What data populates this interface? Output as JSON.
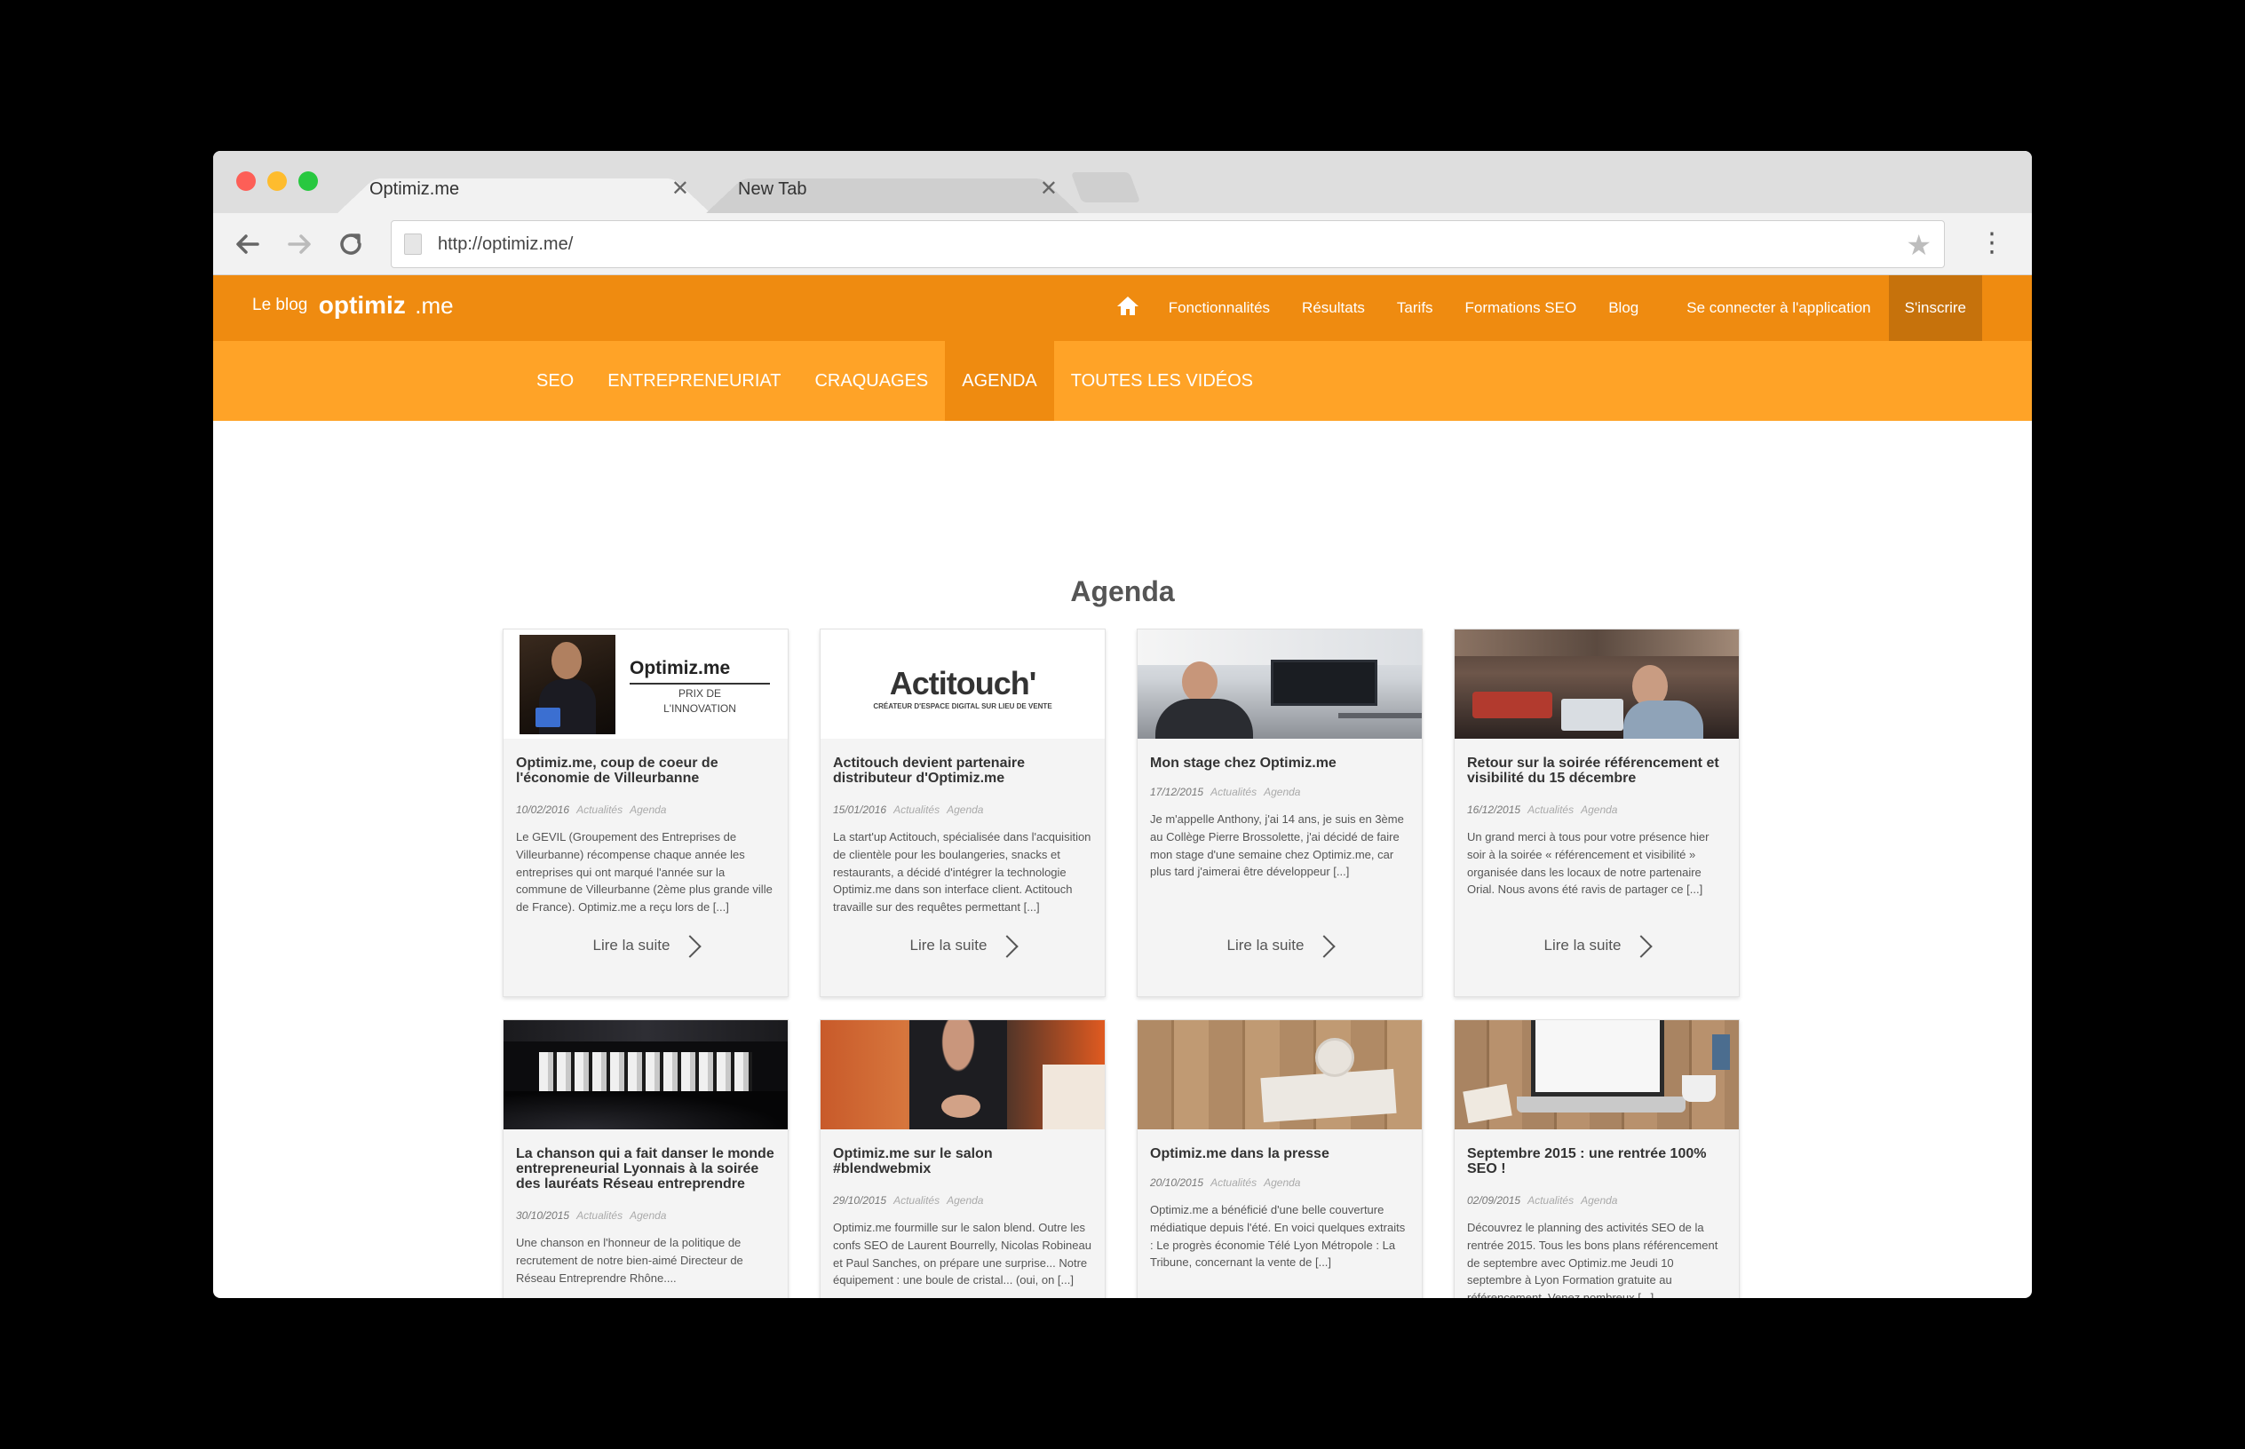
{
  "browser": {
    "tabs": [
      {
        "title": "Optimiz.me",
        "close": "✕"
      },
      {
        "title": "New Tab",
        "close": "✕"
      }
    ],
    "url": "http://optimiz.me/"
  },
  "site": {
    "brand_prefix": "Le blog",
    "brand_logo": "optimiz",
    "brand_suffix": ".me",
    "main_nav": [
      "Fonctionnalités",
      "Résultats",
      "Tarifs",
      "Formations SEO",
      "Blog",
      "Se connecter à l'application"
    ],
    "cta": "S'inscrire",
    "categories": [
      "SEO",
      "ENTREPRENEURIAT",
      "CRAQUAGES",
      "AGENDA",
      "TOUTES LES VIDÉOS"
    ],
    "active_category": "AGENDA",
    "colors": {
      "header": "#ef8b10",
      "category_bar": "#ffa327",
      "cta": "#c6720c"
    }
  },
  "section_title": "Agenda",
  "read_more": "Lire la suite",
  "thumbs": {
    "optimiz_brand": "Optimiz.me",
    "optimiz_prize_line1": "PRIX DE",
    "optimiz_prize_line2": "L'INNOVATION",
    "actitouch_brand": "Actitouch'",
    "actitouch_tagline": "CRÉATEUR D'ESPACE DIGITAL SUR LIEU DE VENTE"
  },
  "cards": [
    {
      "title": "Optimiz.me, coup de coeur de l'économie de Villeurbanne",
      "date": "10/02/2016",
      "tags": [
        "Actualités",
        "Agenda"
      ],
      "excerpt": "Le GEVIL (Groupement des Entreprises de Villeurbanne) récompense chaque année les entreprises qui ont marqué l'année sur la commune de Villeurbanne (2ème plus grande ville de France). Optimiz.me a reçu lors de [...]"
    },
    {
      "title": "Actitouch devient partenaire distributeur d'Optimiz.me",
      "date": "15/01/2016",
      "tags": [
        "Actualités",
        "Agenda"
      ],
      "excerpt": "La start'up Actitouch, spécialisée dans l'acquisition de clientèle pour les boulangeries, snacks et restaurants, a décidé d'intégrer la technologie Optimiz.me dans son interface client. Actitouch travaille sur des requêtes permettant [...]"
    },
    {
      "title": "Mon stage chez Optimiz.me",
      "date": "17/12/2015",
      "tags": [
        "Actualités",
        "Agenda"
      ],
      "excerpt": "Je m'appelle Anthony, j'ai 14 ans, je suis en 3ème au Collège Pierre Brossolette, j'ai décidé de faire mon stage d'une semaine chez Optimiz.me, car plus tard j'aimerai être développeur [...]"
    },
    {
      "title": "Retour sur la soirée référencement et visibilité du 15 décembre",
      "date": "16/12/2015",
      "tags": [
        "Actualités",
        "Agenda"
      ],
      "excerpt": "Un grand merci à tous pour votre présence hier soir à la soirée « référencement et visibilité » organisée dans les locaux de notre partenaire Orial. Nous avons été ravis de partager ce [...]"
    },
    {
      "title": "La chanson qui a fait danser le monde entrepreneurial Lyonnais à la soirée des lauréats Réseau entreprendre",
      "date": "30/10/2015",
      "tags": [
        "Actualités",
        "Agenda"
      ],
      "excerpt": "Une chanson en l'honneur de la politique de recrutement de notre bien-aimé Directeur de Réseau Entreprendre Rhône...."
    },
    {
      "title": "Optimiz.me sur le salon #blendwebmix",
      "date": "29/10/2015",
      "tags": [
        "Actualités",
        "Agenda"
      ],
      "excerpt": "Optimiz.me fourmille sur le salon blend. Outre les confs SEO de Laurent Bourrelly, Nicolas Robineau et Paul Sanches, on prépare une surprise... Notre équipement : une boule de cristal... (oui, on [...]"
    },
    {
      "title": "Optimiz.me dans la presse",
      "date": "20/10/2015",
      "tags": [
        "Actualités",
        "Agenda"
      ],
      "excerpt": "Optimiz.me a bénéficié d'une belle couverture médiatique depuis l'été. En voici quelques extraits : Le progrès économie Télé Lyon Métropole : La Tribune, concernant la vente de [...]"
    },
    {
      "title": "Septembre 2015 : une rentrée 100% SEO !",
      "date": "02/09/2015",
      "tags": [
        "Actualités",
        "Agenda"
      ],
      "excerpt": "Découvrez le planning des activités SEO de la rentrée 2015. Tous les bons plans référencement de septembre avec Optimiz.me Jeudi 10 septembre à Lyon Formation gratuite au référencement. Venez nombreux [...]"
    }
  ]
}
